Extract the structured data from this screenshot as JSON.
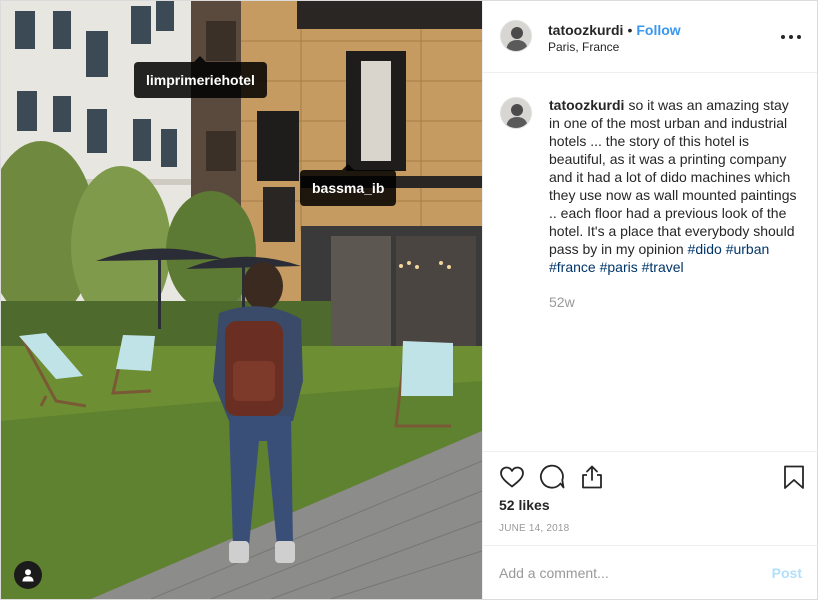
{
  "photo": {
    "tags": [
      {
        "username": "limprimeriehotel"
      },
      {
        "username": "bassma_ib"
      }
    ],
    "user_tag_icon": "person-icon"
  },
  "header": {
    "username": "tatoozkurdi",
    "separator": "•",
    "follow_label": "Follow",
    "location": "Paris, France",
    "more_icon": "more-options-icon"
  },
  "caption": {
    "username": "tatoozkurdi",
    "text": "so it was an amazing stay in one of the most urban and industrial hotels ... the story of this hotel is beautiful, as it was a printing company and it had a lot of dido machines which they use now as wall mounted paintings .. each floor had a previous look of the hotel. It's a place that everybody should pass by in my opinion",
    "hashtags": [
      "#dido",
      "#urban",
      "#france",
      "#paris",
      "#travel"
    ],
    "age": "52w"
  },
  "actions": {
    "icons": [
      "heart-icon",
      "comment-icon",
      "share-icon",
      "bookmark-icon"
    ],
    "likes": "52 likes",
    "date": "June 14, 2018"
  },
  "add_comment": {
    "placeholder": "Add a comment...",
    "post_label": "Post"
  },
  "colors": {
    "accent": "#3897f0",
    "post_disabled": "#b2dffc",
    "hashtag": "#003569",
    "muted": "#999999",
    "border": "#efefef"
  }
}
